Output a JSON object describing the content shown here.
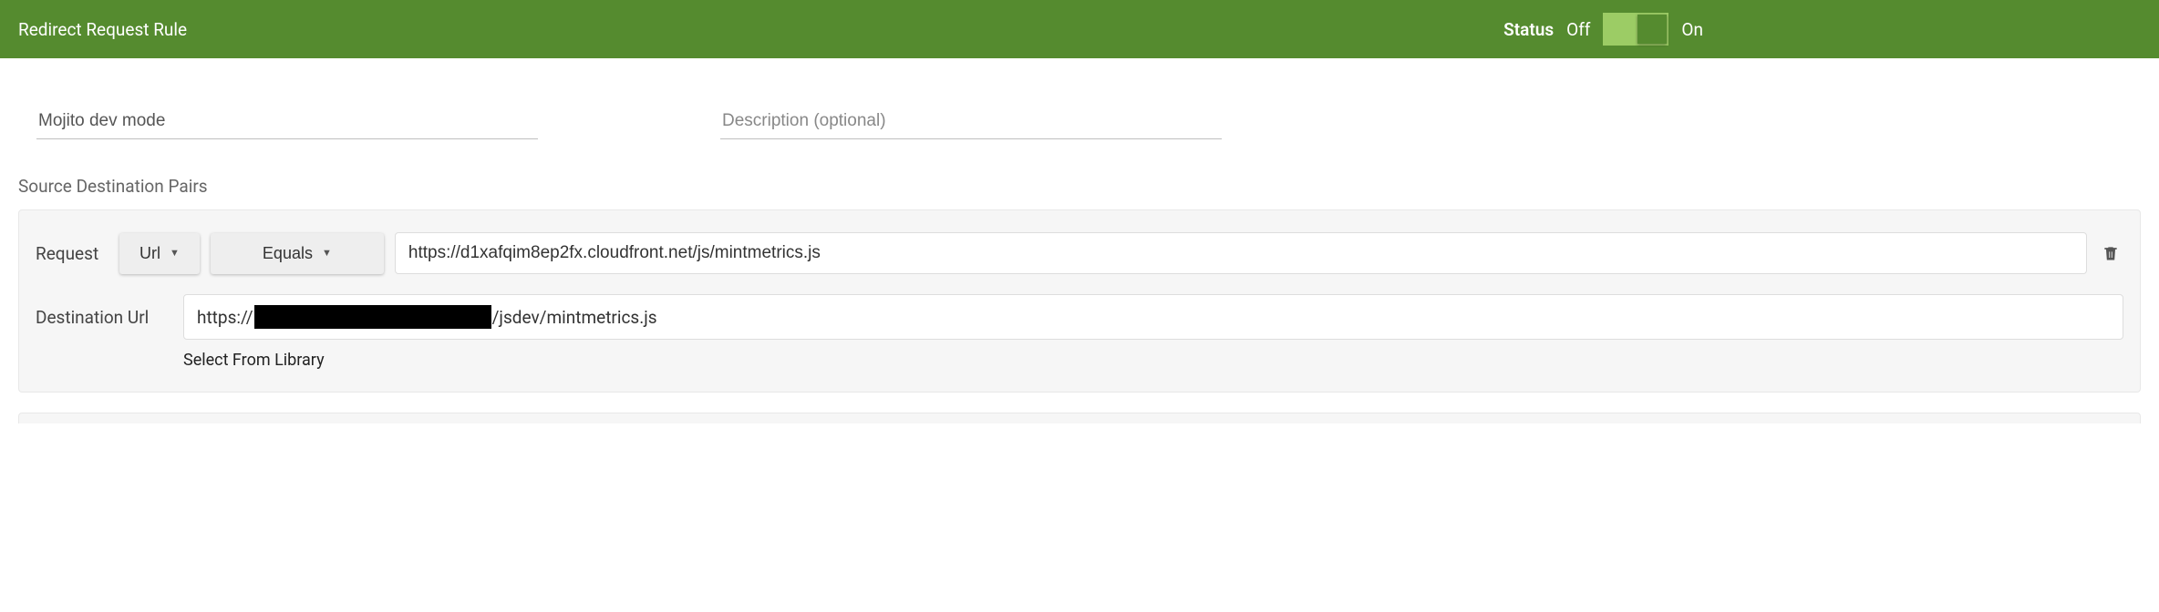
{
  "header": {
    "title": "Redirect Request Rule",
    "status_label": "Status",
    "off_label": "Off",
    "on_label": "On"
  },
  "inputs": {
    "name_value": "Mojito dev mode",
    "description_placeholder": "Description (optional)"
  },
  "section": {
    "source_destination_label": "Source Destination Pairs",
    "request_label": "Request",
    "destination_label": "Destination Url",
    "url_dropdown": "Url",
    "equals_dropdown": "Equals",
    "request_value": "https://d1xafqim8ep2fx.cloudfront.net/js/mintmetrics.js",
    "destination_prefix": "https://",
    "destination_suffix": "/jsdev/mintmetrics.js",
    "select_library": "Select From Library"
  }
}
